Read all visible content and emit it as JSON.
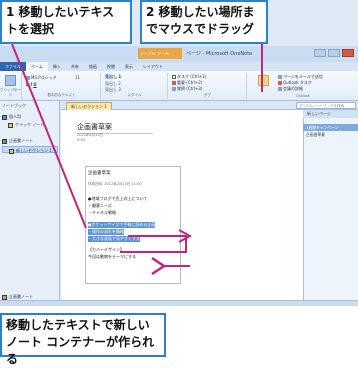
{
  "callouts": {
    "step1": "1 移動したいテキストを選択",
    "step2": "2 移動したい場所までマウスでドラッグ",
    "result": "移動したテキストで新しいノート コンテナーが作られる"
  },
  "window": {
    "contextual_tab": "テーブル ツール",
    "title": "ページ - Microsoft OneNote"
  },
  "ribbon": {
    "tabs": [
      "ファイル",
      "ホーム",
      "挿入",
      "共有",
      "描画",
      "校閲",
      "表示",
      "レイアウト"
    ],
    "active_tab": "ホーム",
    "font_size": "11",
    "style_heading1": "見出し 1",
    "style_heading2": "見出し 2",
    "style_heading3": "見出し 3",
    "tag_todo": "タスク (Ctrl+1)",
    "tag_important": "重要 (Ctrl+2)",
    "tag_question": "質問 (Ctrl+3)",
    "outlook_task": "Outlook タスク",
    "page_mail": "ページをメールで送信",
    "meeting": "会議の詳細",
    "group_clipboard": "クリップボード",
    "group_text": "基本的なテキスト",
    "group_styles": "スタイル",
    "group_tags": "タグ",
    "group_outlook": "Outlook"
  },
  "nav": {
    "header": "ノートブック",
    "items": [
      {
        "label": "個人用"
      },
      {
        "label": "クイック ノート"
      },
      {
        "label": "企画書ノート"
      },
      {
        "label": "新しいセクション 1"
      }
    ],
    "footer": "企画書ノート"
  },
  "section_tab": "新しいセクション 1",
  "search_placeholder": "すべてのノートブックを検索",
  "page": {
    "title": "企画書草案",
    "date": "2012年2月13日",
    "time": "9:50"
  },
  "note": {
    "heading": "企画書草案",
    "created": "作成日時: 2012年2月13日 11:00",
    "line1": "●地域ブログで売上向上について",
    "line2": "・顧客ニーズ",
    "line3": "・チャネル戦略",
    "line4": "●ポケットサイズで手軽に読める企画",
    "line5": "・操作の流れを簡略",
    "line6": "・大きな画面で見やすくする",
    "line7": "【カバーデザイン】",
    "line8": "今回は動物をテーマにする"
  },
  "pages_pane": {
    "new_page": "新しいページ",
    "items": [
      {
        "label": "1週間キャンペーン",
        "selected": true
      },
      {
        "label": "企画書草案",
        "selected": false
      }
    ]
  },
  "colors": {
    "callout_border": "#2a82c9",
    "arrow": "#c2247e",
    "selection": "#5b93d6"
  }
}
